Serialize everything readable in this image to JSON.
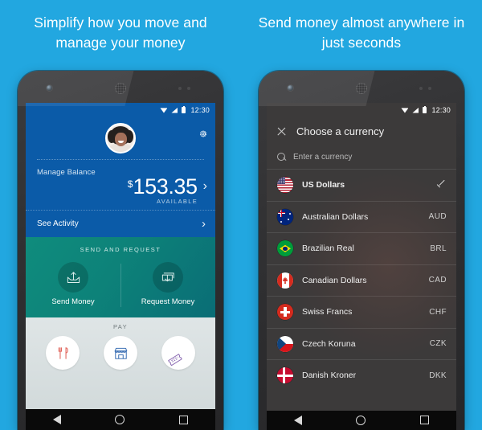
{
  "background_color": "#22a7e0",
  "panels": [
    {
      "headline": "Simplify how you move and manage your money",
      "statusbar": {
        "time": "12:30",
        "wifi_icon": "wifi-icon",
        "signal_icon": "signal-icon",
        "battery_icon": "battery-icon"
      },
      "wallet": {
        "avatar_icon": "user-avatar",
        "settings_icon": "gear-icon",
        "balance_label": "Manage Balance",
        "currency_symbol": "$",
        "balance_amount": "153.35",
        "balance_sublabel": "AVAILABLE",
        "balance_chevron": "›",
        "activity_label": "See Activity",
        "activity_chevron": "›",
        "send_request_title": "SEND AND REQUEST",
        "send_label": "Send Money",
        "send_icon": "send-money-icon",
        "request_label": "Request Money",
        "request_icon": "request-money-icon",
        "pay_title": "PAY",
        "pay_items": [
          {
            "name": "restaurant-icon",
            "color": "#e2685f"
          },
          {
            "name": "store-icon",
            "color": "#3f72b5"
          },
          {
            "name": "ticket-icon",
            "color": "#8e6fb5"
          }
        ]
      }
    },
    {
      "headline": "Send money almost anywhere in just seconds",
      "statusbar": {
        "time": "12:30",
        "wifi_icon": "wifi-icon",
        "signal_icon": "signal-icon",
        "battery_icon": "battery-icon"
      },
      "currency_picker": {
        "close_icon": "close-icon",
        "title": "Choose a currency",
        "search_icon": "search-icon",
        "search_placeholder": "Enter a currency",
        "search_value": "",
        "items": [
          {
            "flag": "us-flag-icon",
            "name": "US Dollars",
            "code": "",
            "selected": true
          },
          {
            "flag": "au-flag-icon",
            "name": "Australian Dollars",
            "code": "AUD",
            "selected": false
          },
          {
            "flag": "br-flag-icon",
            "name": "Brazilian Real",
            "code": "BRL",
            "selected": false
          },
          {
            "flag": "ca-flag-icon",
            "name": "Canadian Dollars",
            "code": "CAD",
            "selected": false
          },
          {
            "flag": "ch-flag-icon",
            "name": "Swiss Francs",
            "code": "CHF",
            "selected": false
          },
          {
            "flag": "cz-flag-icon",
            "name": "Czech Koruna",
            "code": "CZK",
            "selected": false
          },
          {
            "flag": "dk-flag-icon",
            "name": "Danish Kroner",
            "code": "DKK",
            "selected": false
          }
        ]
      }
    }
  ],
  "navbar": {
    "back_icon": "nav-back-icon",
    "home_icon": "nav-home-icon",
    "recents_icon": "nav-recents-icon"
  }
}
